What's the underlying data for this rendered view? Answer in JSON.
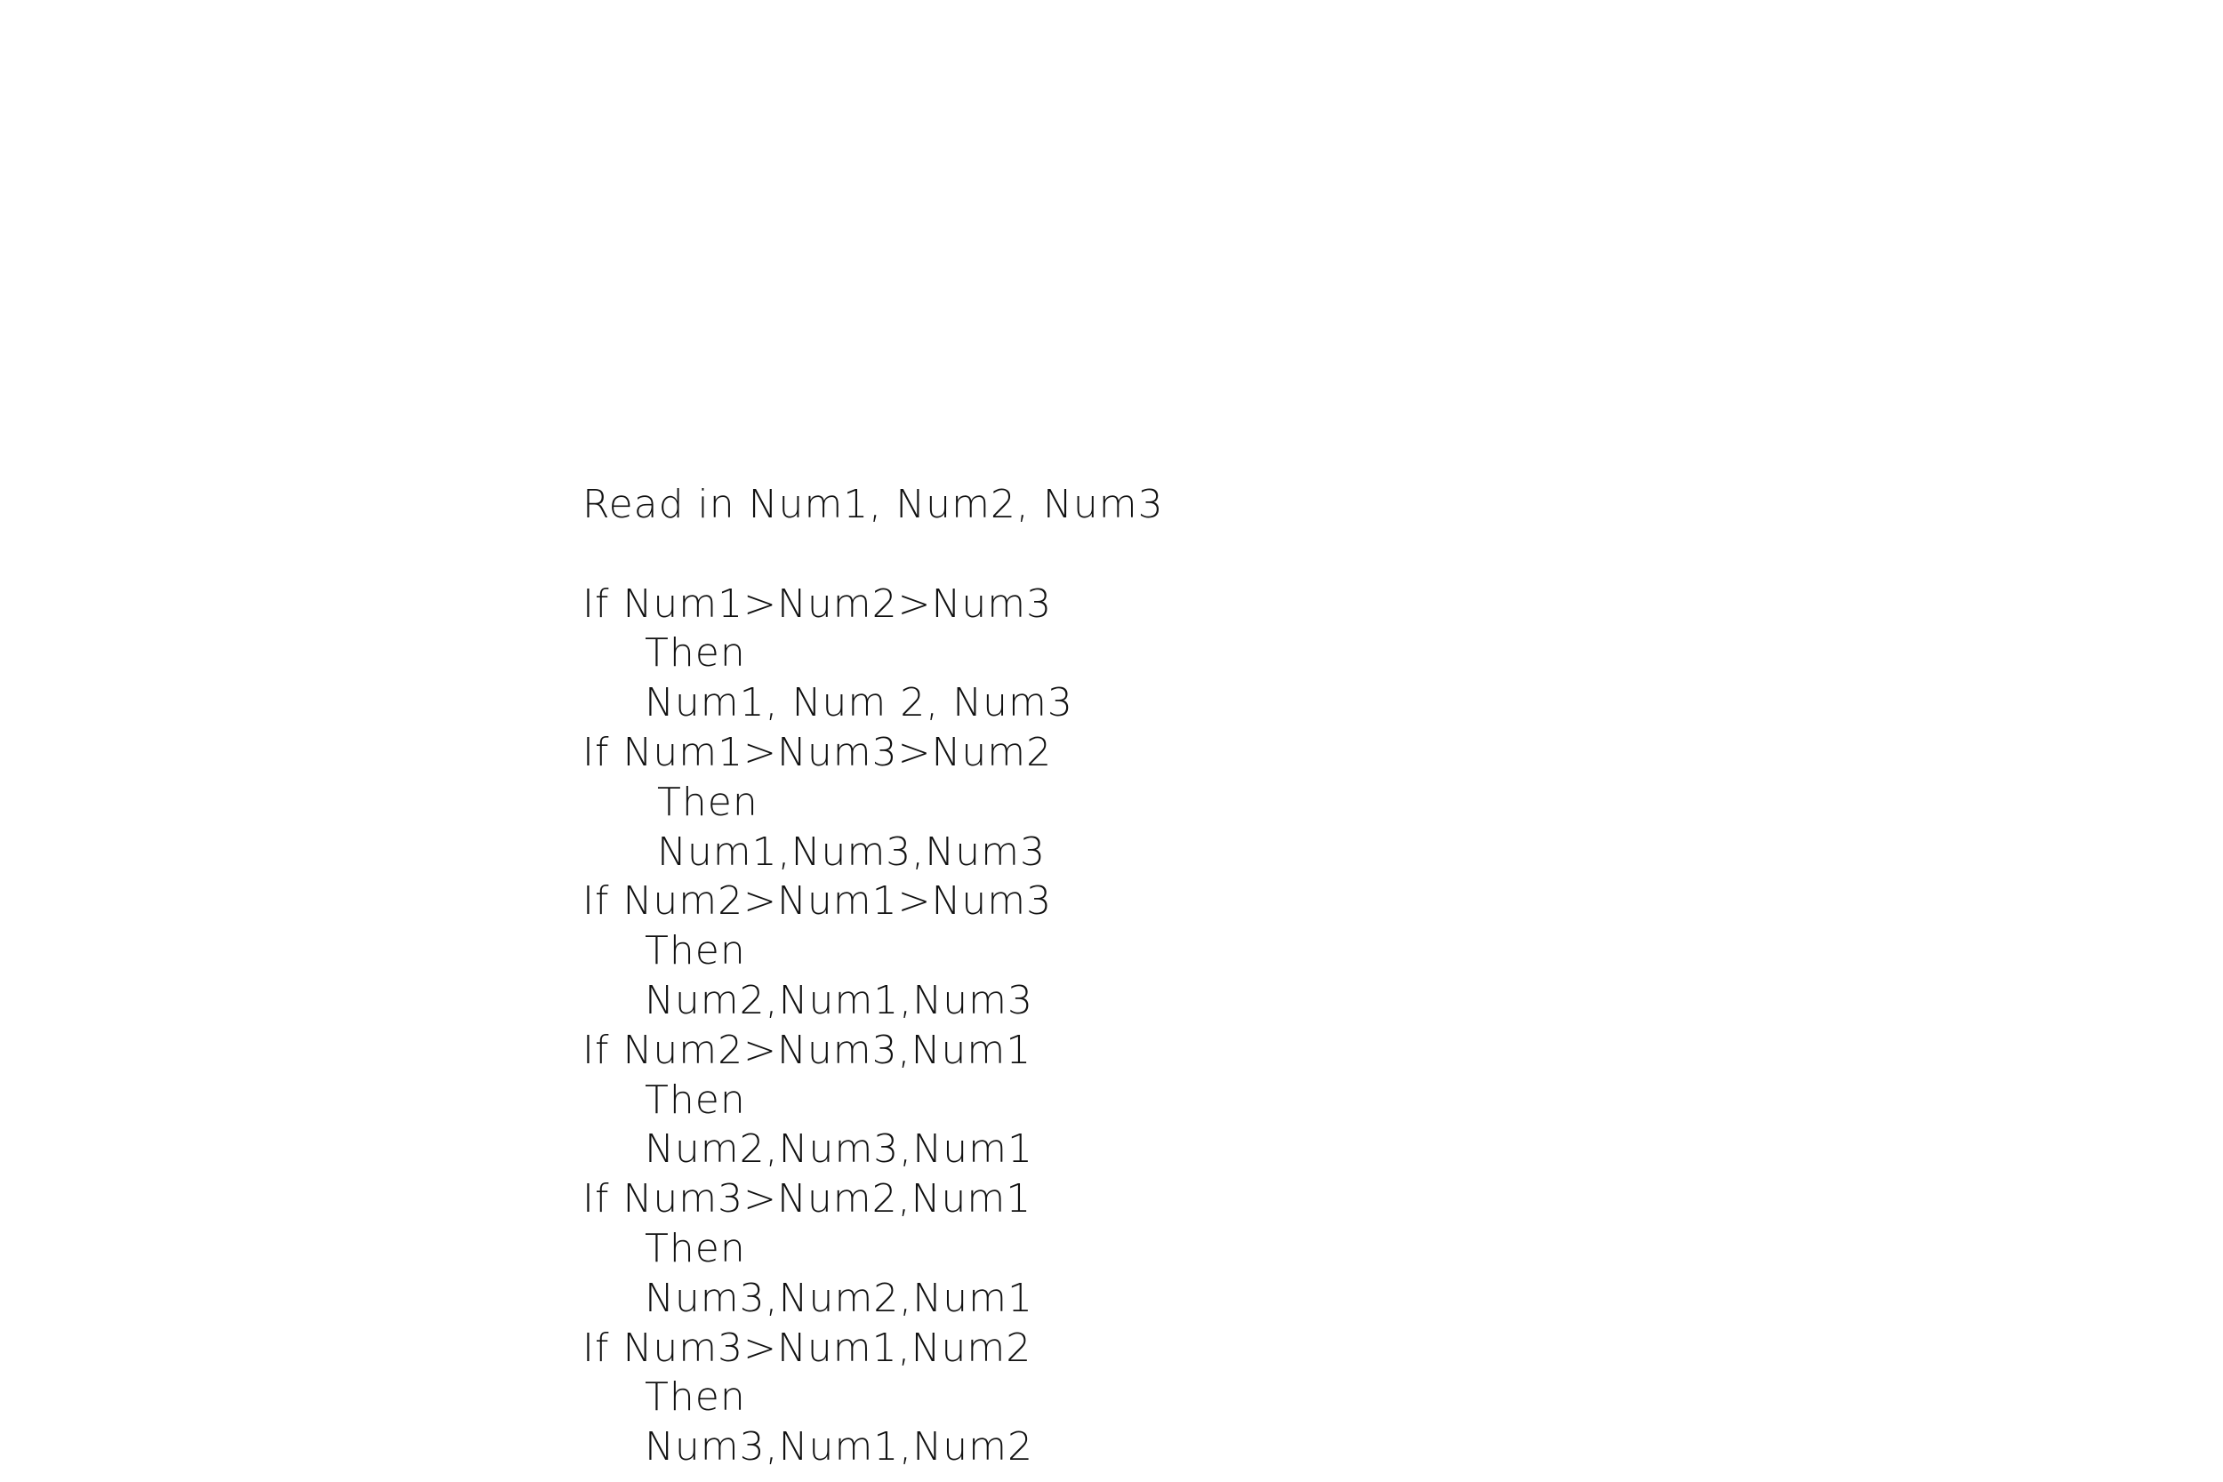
{
  "document": {
    "header_line": "Read in Num1, Num2, Num3",
    "blocks": [
      {
        "condition": "If Num1>Num2>Num3",
        "then": "Then",
        "result": "Num1, Num 2, Num3"
      },
      {
        "condition": "If Num1>Num3>Num2",
        "then": "Then",
        "result": "Num1,Num3,Num3"
      },
      {
        "condition": "If Num2>Num1>Num3",
        "then": "Then",
        "result": "Num2,Num1,Num3"
      },
      {
        "condition": "If Num2>Num3,Num1",
        "then": "Then",
        "result": "Num2,Num3,Num1"
      },
      {
        "condition": "If Num3>Num2,Num1",
        "then": "Then",
        "result": "Num3,Num2,Num1"
      },
      {
        "condition": "If Num3>Num1,Num2",
        "then": "Then",
        "result": "Num3,Num1,Num2"
      }
    ]
  }
}
